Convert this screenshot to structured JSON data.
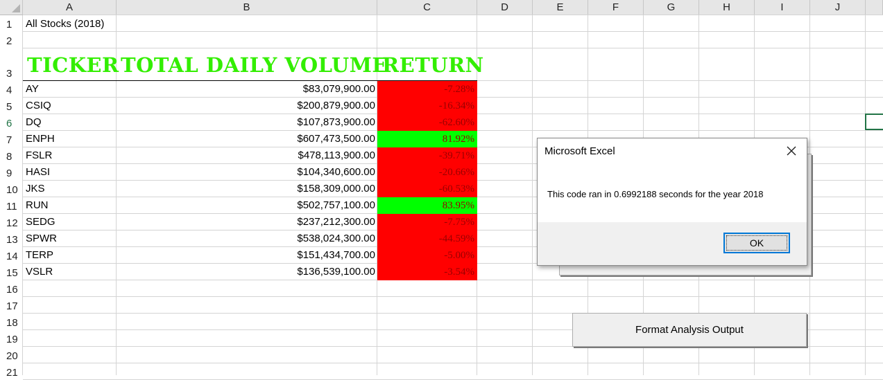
{
  "columns": [
    "A",
    "B",
    "C",
    "D",
    "E",
    "F",
    "G",
    "H",
    "I",
    "J"
  ],
  "rows": [
    "1",
    "2",
    "3",
    "4",
    "5",
    "6",
    "7",
    "8",
    "9",
    "10",
    "11",
    "12",
    "13",
    "14",
    "15",
    "16",
    "17",
    "18",
    "19",
    "20",
    "21"
  ],
  "sheet": {
    "title": "All Stocks (2018)",
    "headers": {
      "ticker": "TICKER",
      "volume": "TOTAL DAILY VOLUME",
      "return": "RETURN"
    },
    "data": [
      {
        "ticker": "AY",
        "volume": "$83,079,900.00",
        "return": "-7.28%",
        "status": "negative"
      },
      {
        "ticker": "CSIQ",
        "volume": "$200,879,900.00",
        "return": "-16.34%",
        "status": "negative"
      },
      {
        "ticker": "DQ",
        "volume": "$107,873,900.00",
        "return": "-62.60%",
        "status": "negative"
      },
      {
        "ticker": "ENPH",
        "volume": "$607,473,500.00",
        "return": "81.92%",
        "status": "positive"
      },
      {
        "ticker": "FSLR",
        "volume": "$478,113,900.00",
        "return": "-39.71%",
        "status": "negative"
      },
      {
        "ticker": "HASI",
        "volume": "$104,340,600.00",
        "return": "-20.66%",
        "status": "negative"
      },
      {
        "ticker": "JKS",
        "volume": "$158,309,000.00",
        "return": "-60.53%",
        "status": "negative"
      },
      {
        "ticker": "RUN",
        "volume": "$502,757,100.00",
        "return": "83.95%",
        "status": "positive"
      },
      {
        "ticker": "SEDG",
        "volume": "$237,212,300.00",
        "return": "-7.75%",
        "status": "negative"
      },
      {
        "ticker": "SPWR",
        "volume": "$538,024,300.00",
        "return": "-44.59%",
        "status": "negative"
      },
      {
        "ticker": "TERP",
        "volume": "$151,434,700.00",
        "return": "-5.00%",
        "status": "negative"
      },
      {
        "ticker": "VSLR",
        "volume": "$136,539,100.00",
        "return": "-3.54%",
        "status": "negative"
      }
    ]
  },
  "colors": {
    "positive": "#00ff00",
    "negative": "#ff0000",
    "header_text": "#33ee00",
    "selection": "#217346"
  },
  "buttons": {
    "format_label": "Format Analysis Output"
  },
  "dialog": {
    "title": "Microsoft Excel",
    "message": "This code ran in 0.6992188 seconds for the year 2018",
    "ok_label": "OK",
    "close_icon": "close-icon"
  }
}
